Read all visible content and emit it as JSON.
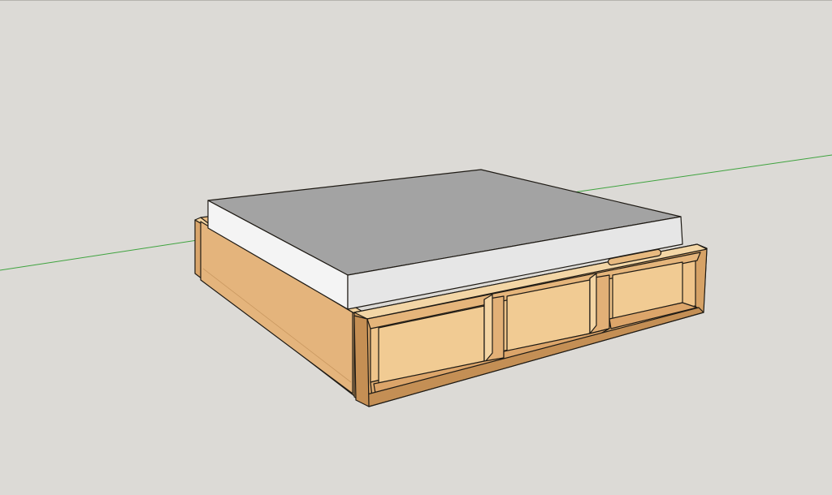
{
  "scene": {
    "background_color": "#dcdad6",
    "green_axis_color": "#3ea33e",
    "mattress": {
      "top_color": "#a3a3a3",
      "side_color": "#f4f4f4",
      "front_color": "#e4e4e4"
    },
    "bed_frame": {
      "wood_light": "#f0cc94",
      "wood_mid": "#e6b57d",
      "wood_dark": "#d19e66",
      "wood_shadow": "#b98650",
      "edge_color": "#1e1a14"
    },
    "storage_compartments": 3,
    "handle_slot": "handle-slot-icon"
  }
}
